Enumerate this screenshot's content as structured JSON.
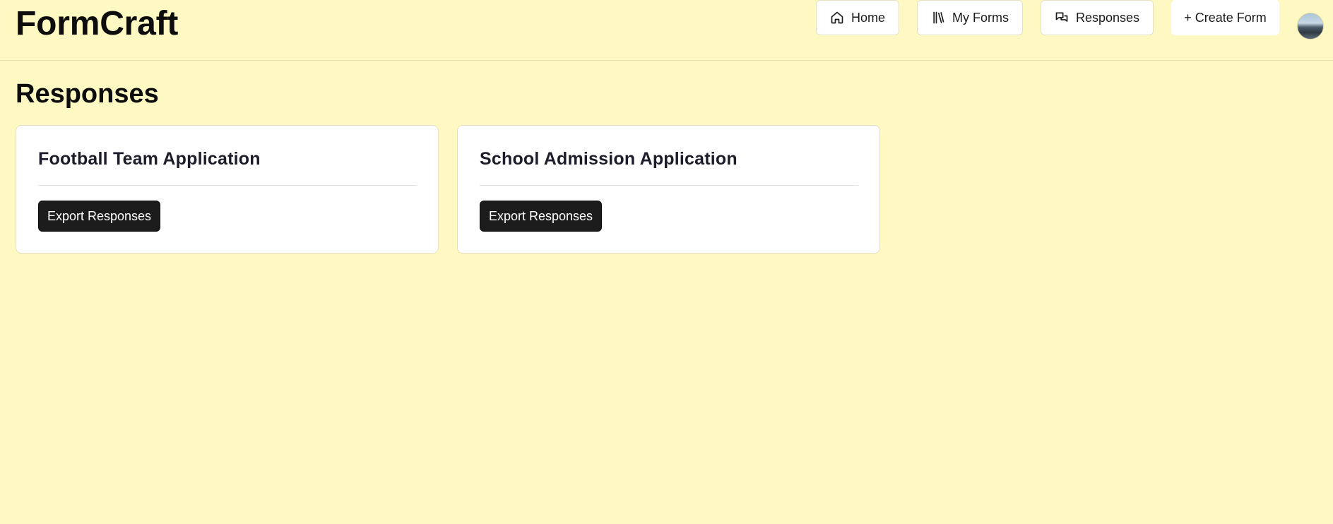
{
  "app": {
    "name": "FormCraft"
  },
  "nav": {
    "home_label": "Home",
    "my_forms_label": "My Forms",
    "responses_label": "Responses",
    "create_form_label": "+ Create Form",
    "icons": {
      "home": "home-icon",
      "my_forms": "library-icon",
      "responses": "messages-icon",
      "avatar": "user-avatar"
    }
  },
  "page": {
    "title": "Responses"
  },
  "cards": [
    {
      "title": "Football Team Application",
      "button_label": "Export Responses"
    },
    {
      "title": "School Admission Application",
      "button_label": "Export Responses"
    }
  ],
  "colors": {
    "background": "#fef9c3",
    "card": "#ffffff",
    "primary_button": "#1c1c1c"
  }
}
